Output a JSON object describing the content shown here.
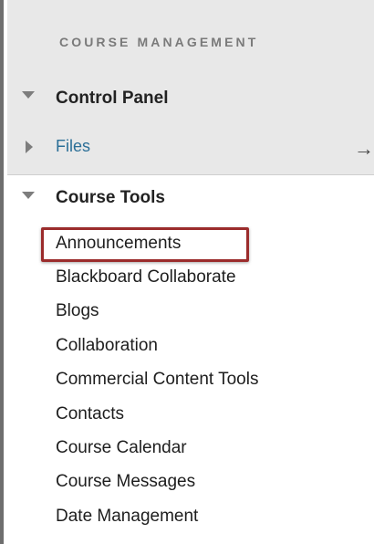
{
  "course_management": {
    "title": "COURSE MANAGEMENT",
    "control_panel": "Control Panel",
    "files": "Files",
    "files_arrow": "→"
  },
  "course_tools": {
    "title": "Course Tools",
    "items": [
      "Announcements",
      "Blackboard Collaborate",
      "Blogs",
      "Collaboration",
      "Commercial Content Tools",
      "Contacts",
      "Course Calendar",
      "Course Messages",
      "Date Management"
    ]
  },
  "colors": {
    "panel_bg": "#e8e8e8",
    "link_blue": "#2b6f97",
    "highlight_border": "#9b2c2c"
  }
}
